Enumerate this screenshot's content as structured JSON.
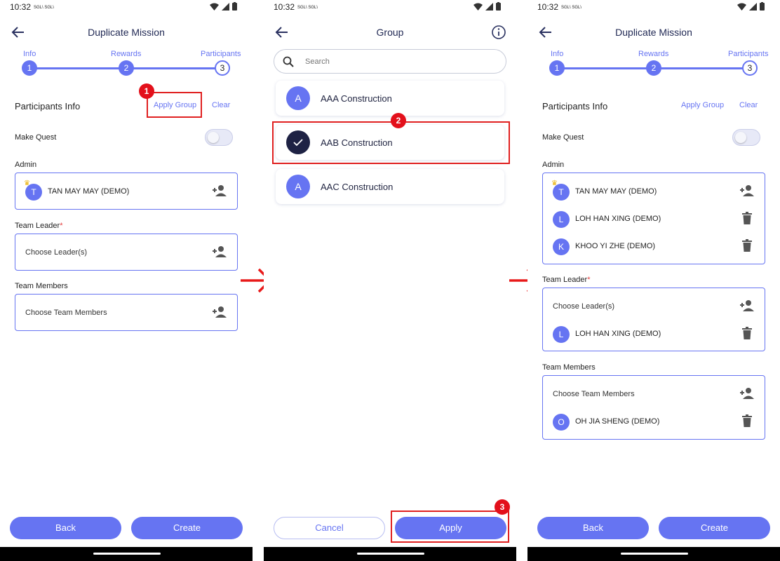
{
  "status": {
    "time": "10:32",
    "signal": "SGL\\ SGL\\"
  },
  "panel1": {
    "title": "Duplicate Mission",
    "steps": [
      "Info",
      "Rewards",
      "Participants"
    ],
    "step_numbers": [
      "1",
      "2",
      "3"
    ],
    "section_title": "Participants Info",
    "apply_group": "Apply Group",
    "clear": "Clear",
    "make_quest": "Make Quest",
    "admin_label": "Admin",
    "admin": {
      "initial": "T",
      "name": "TAN MAY MAY (DEMO)"
    },
    "team_leader_label": "Team Leader",
    "required_mark": "*",
    "choose_leader": "Choose Leader(s)",
    "team_members_label": "Team Members",
    "choose_members": "Choose Team Members",
    "back": "Back",
    "create": "Create"
  },
  "panel2": {
    "title": "Group",
    "search_placeholder": "Search",
    "groups": [
      {
        "initial": "A",
        "name": "AAA Construction",
        "selected": false
      },
      {
        "initial": "",
        "name": "AAB Construction",
        "selected": true
      },
      {
        "initial": "A",
        "name": "AAC Construction",
        "selected": false
      }
    ],
    "cancel": "Cancel",
    "apply": "Apply"
  },
  "panel3": {
    "title": "Duplicate Mission",
    "steps": [
      "Info",
      "Rewards",
      "Participants"
    ],
    "step_numbers": [
      "1",
      "2",
      "3"
    ],
    "section_title": "Participants Info",
    "apply_group": "Apply Group",
    "clear": "Clear",
    "make_quest": "Make Quest",
    "admin_label": "Admin",
    "admins": [
      {
        "initial": "T",
        "name": "TAN MAY MAY (DEMO)"
      },
      {
        "initial": "L",
        "name": "LOH HAN XING (DEMO)"
      },
      {
        "initial": "K",
        "name": "KHOO YI ZHE (DEMO)"
      }
    ],
    "team_leader_label": "Team Leader",
    "required_mark": "*",
    "choose_leader": "Choose Leader(s)",
    "leader": {
      "initial": "L",
      "name": "LOH HAN XING (DEMO)"
    },
    "team_members_label": "Team Members",
    "choose_members": "Choose Team Members",
    "member": {
      "initial": "O",
      "name": "OH JIA SHENG (DEMO)"
    },
    "back": "Back",
    "create": "Create"
  },
  "annotations": {
    "badge1": "1",
    "badge2": "2",
    "badge3": "3"
  },
  "colors": {
    "accent": "#6674f2",
    "selected_avatar": "#1e2244",
    "highlight": "#e02020"
  }
}
